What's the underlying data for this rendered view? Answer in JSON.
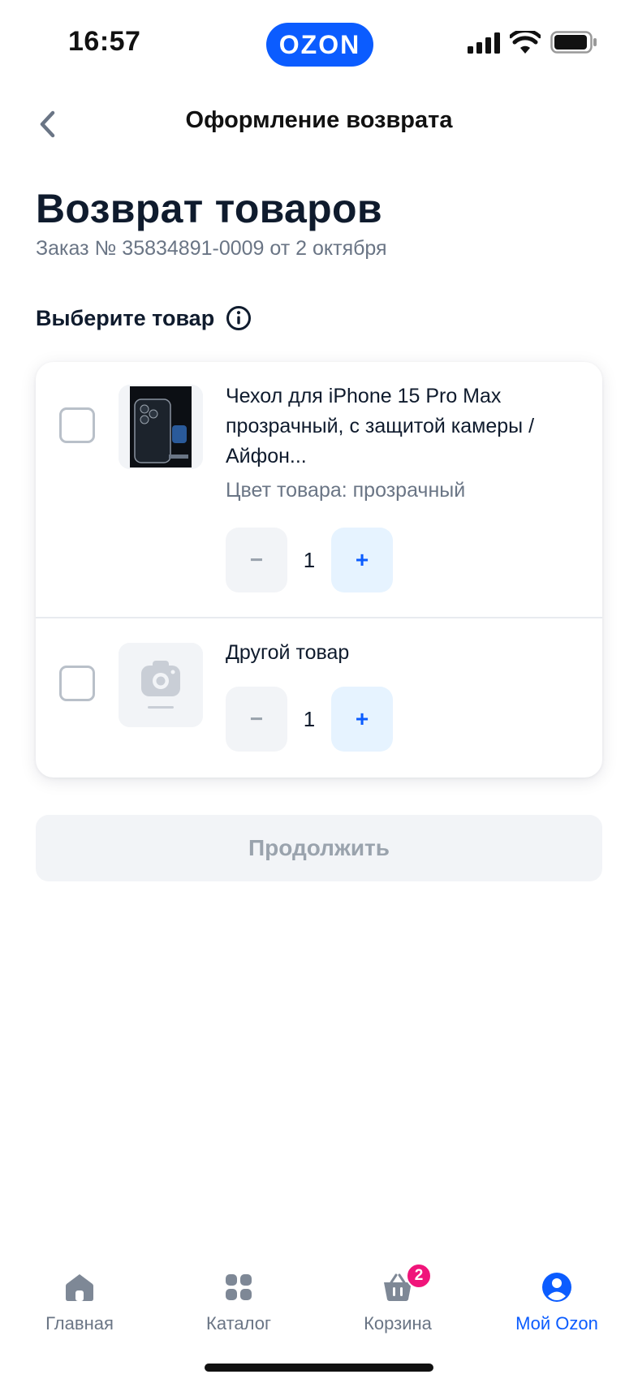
{
  "status_bar": {
    "time": "16:57",
    "brand": "OZON",
    "icons": [
      "cellular-signal-icon",
      "wifi-icon",
      "battery-icon"
    ]
  },
  "header": {
    "title": "Оформление возврата",
    "back_icon": "chevron-left-icon"
  },
  "page": {
    "title": "Возврат товаров",
    "order_line": "Заказ № 35834891-0009 от 2 октября",
    "section_title": "Выберите товар",
    "section_info_icon": "info-icon"
  },
  "items": [
    {
      "name": "Чехол для iPhone 15 Pro Max прозрачный, с защитой камеры / Айфон...",
      "attribute": "Цвет товара: прозрачный",
      "quantity": "1",
      "selected": false,
      "image_caption": "IPHONE 15 PRO MAX"
    },
    {
      "name": "Другой товар",
      "quantity": "1",
      "selected": false,
      "image_caption": "Нет фотографии"
    }
  ],
  "stepper": {
    "minus_label": "−",
    "plus_label": "+"
  },
  "continue_button": {
    "label": "Продолжить",
    "enabled": false
  },
  "tabbar": {
    "tabs": [
      {
        "label": "Главная",
        "icon": "home-icon",
        "active": false
      },
      {
        "label": "Каталог",
        "icon": "catalog-grid-icon",
        "active": false
      },
      {
        "label": "Корзина",
        "icon": "basket-icon",
        "active": false,
        "badge": "2"
      },
      {
        "label": "Мой Ozon",
        "icon": "profile-icon",
        "active": true
      }
    ]
  },
  "colors": {
    "brand_blue": "#0b5cff",
    "badge_pink": "#f0147a",
    "muted_text": "#6a7585",
    "primary_text": "#0f1b2d",
    "disabled_button_bg": "#f2f4f7"
  }
}
